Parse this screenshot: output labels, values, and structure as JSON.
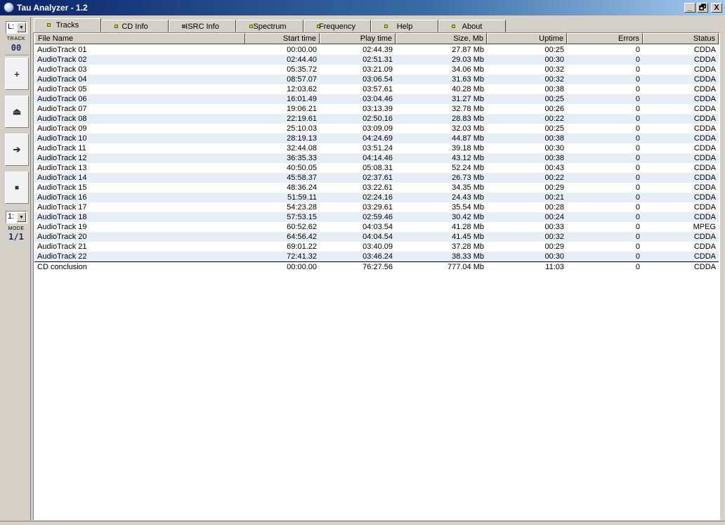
{
  "window": {
    "title": "Tau Analyzer - 1.2",
    "buttons": [
      "_",
      "🗗",
      "X"
    ]
  },
  "leftbar": {
    "drive_combo": "L:",
    "track_caption": "TRACK",
    "track_number": "00",
    "buttons": [
      {
        "icon": "plus-icon",
        "glyph": "+"
      },
      {
        "icon": "eject-icon",
        "glyph": "⏏"
      },
      {
        "icon": "arrow-right-icon",
        "glyph": "➔"
      },
      {
        "icon": "stop-icon",
        "glyph": "■"
      }
    ],
    "mode_combo": "1:",
    "mode_caption": "MODE",
    "mode_value": "1/1"
  },
  "tabs": [
    {
      "label": "Tracks",
      "led": "on",
      "active": true
    },
    {
      "label": "CD Info",
      "led": "on"
    },
    {
      "label": "ISRC Info",
      "led": "off"
    },
    {
      "label": "Spectrum",
      "led": "on"
    },
    {
      "label": "Frequency",
      "led": "on"
    },
    {
      "label": "Help",
      "led": "on"
    },
    {
      "label": "About",
      "led": "on"
    }
  ],
  "table": {
    "columns": [
      "File Name",
      "Start time",
      "Play time",
      "Size, Mb",
      "Uptime",
      "Errors",
      "Status"
    ],
    "rows": [
      [
        "AudioTrack 01",
        "00:00.00",
        "02:44.39",
        "27.87 Mb",
        "00:25",
        "0",
        "CDDA"
      ],
      [
        "AudioTrack 02",
        "02:44.40",
        "02:51.31",
        "29.03 Mb",
        "00:30",
        "0",
        "CDDA"
      ],
      [
        "AudioTrack 03",
        "05:35.72",
        "03:21.09",
        "34.06 Mb",
        "00:32",
        "0",
        "CDDA"
      ],
      [
        "AudioTrack 04",
        "08:57.07",
        "03:06.54",
        "31.63 Mb",
        "00:32",
        "0",
        "CDDA"
      ],
      [
        "AudioTrack 05",
        "12:03.62",
        "03:57.61",
        "40.28 Mb",
        "00:38",
        "0",
        "CDDA"
      ],
      [
        "AudioTrack 06",
        "16:01.49",
        "03:04.46",
        "31.27 Mb",
        "00:25",
        "0",
        "CDDA"
      ],
      [
        "AudioTrack 07",
        "19:06.21",
        "03:13.39",
        "32.78 Mb",
        "00:26",
        "0",
        "CDDA"
      ],
      [
        "AudioTrack 08",
        "22:19.61",
        "02:50.16",
        "28.83 Mb",
        "00:22",
        "0",
        "CDDA"
      ],
      [
        "AudioTrack 09",
        "25:10.03",
        "03:09.09",
        "32.03 Mb",
        "00:25",
        "0",
        "CDDA"
      ],
      [
        "AudioTrack 10",
        "28:19.13",
        "04:24.69",
        "44.87 Mb",
        "00:38",
        "0",
        "CDDA"
      ],
      [
        "AudioTrack 11",
        "32:44.08",
        "03:51.24",
        "39.18 Mb",
        "00:30",
        "0",
        "CDDA"
      ],
      [
        "AudioTrack 12",
        "36:35.33",
        "04:14.46",
        "43.12 Mb",
        "00:38",
        "0",
        "CDDA"
      ],
      [
        "AudioTrack 13",
        "40:50.05",
        "05:08.31",
        "52.24 Mb",
        "00:43",
        "0",
        "CDDA"
      ],
      [
        "AudioTrack 14",
        "45:58.37",
        "02:37.61",
        "26.73 Mb",
        "00:22",
        "0",
        "CDDA"
      ],
      [
        "AudioTrack 15",
        "48:36.24",
        "03:22.61",
        "34.35 Mb",
        "00:29",
        "0",
        "CDDA"
      ],
      [
        "AudioTrack 16",
        "51:59.11",
        "02:24.16",
        "24.43 Mb",
        "00:21",
        "0",
        "CDDA"
      ],
      [
        "AudioTrack 17",
        "54:23.28",
        "03:29.61",
        "35.54 Mb",
        "00:28",
        "0",
        "CDDA"
      ],
      [
        "AudioTrack 18",
        "57:53.15",
        "02:59.46",
        "30.42 Mb",
        "00:24",
        "0",
        "CDDA"
      ],
      [
        "AudioTrack 19",
        "60:52.62",
        "04:03.54",
        "41.28 Mb",
        "00:33",
        "0",
        "MPEG"
      ],
      [
        "AudioTrack 20",
        "64:56.42",
        "04:04.54",
        "41.45 Mb",
        "00:32",
        "0",
        "CDDA"
      ],
      [
        "AudioTrack 21",
        "69:01.22",
        "03:40.09",
        "37.28 Mb",
        "00:29",
        "0",
        "CDDA"
      ],
      [
        "AudioTrack 22",
        "72:41.32",
        "03:46.24",
        "38.33 Mb",
        "00:30",
        "0",
        "CDDA"
      ]
    ],
    "total": [
      "CD conclusion",
      "00:00.00",
      "76:27.56",
      "777.04 Mb",
      "11:03",
      "0",
      "CDDA"
    ]
  }
}
